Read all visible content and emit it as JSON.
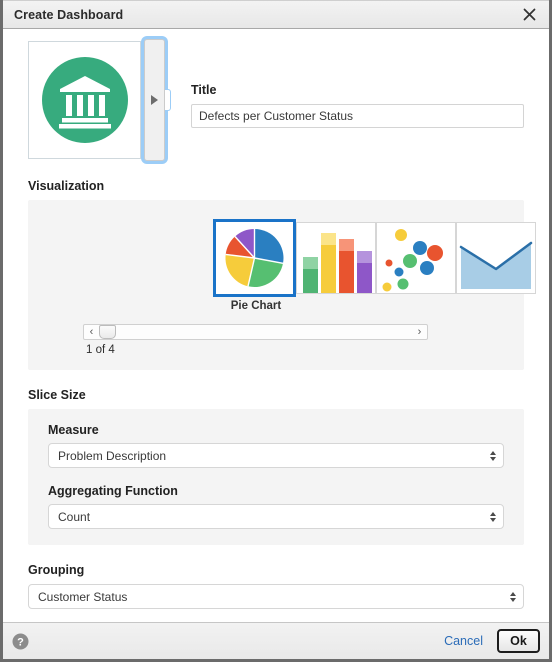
{
  "window": {
    "title": "Create Dashboard",
    "close_icon": "close-icon"
  },
  "header": {
    "app_icon": "bank-icon",
    "expand_arrow_icon": "triangle-right-icon",
    "title_label": "Title",
    "title_value": "Defects per Customer Status",
    "title_placeholder": "Title"
  },
  "visualization": {
    "section_label": "Visualization",
    "selected_caption": "Pie Chart",
    "page_indicator": "1 of 4",
    "prev_arrow": "‹",
    "next_arrow": "›",
    "thumbnails": [
      {
        "name": "Pie Chart",
        "type": "pie",
        "selected": true
      },
      {
        "name": "Bar Chart",
        "type": "bar",
        "selected": false
      },
      {
        "name": "Bubble Chart",
        "type": "scatter",
        "selected": false
      },
      {
        "name": "Area Chart",
        "type": "area",
        "selected": false
      }
    ]
  },
  "slice_size": {
    "section_label": "Slice Size",
    "measure_label": "Measure",
    "measure_value": "Problem Description",
    "aggregating_label": "Aggregating Function",
    "aggregating_value": "Count"
  },
  "grouping": {
    "section_label": "Grouping",
    "value": "Customer Status"
  },
  "footer": {
    "help_icon": "help-icon",
    "cancel_label": "Cancel",
    "ok_label": "Ok"
  },
  "colors": {
    "accent_blue": "#1a73c8",
    "focus_blue": "#9ccdf7",
    "icon_green": "#37ab7e",
    "link_blue": "#2b6cb8",
    "panel_gray": "#f4f4f4",
    "pie_blue": "#2a7fc1",
    "pie_green": "#56bf71",
    "pie_yellow": "#f6cc3b",
    "pie_orange": "#e8542f",
    "pie_purple": "#8e57c8"
  },
  "chart_data": [
    {
      "type": "pie",
      "title": "Pie Chart",
      "categories": [
        "Blue",
        "Green",
        "Yellow",
        "Orange",
        "Purple"
      ],
      "values": [
        22,
        28,
        20,
        13,
        17
      ],
      "legend": "none"
    },
    {
      "type": "bar",
      "title": "Bar Chart",
      "categories": [
        "Green",
        "Yellow",
        "Orange",
        "Purple"
      ],
      "series": [
        {
          "name": "Base",
          "values": [
            30,
            62,
            50,
            38
          ]
        },
        {
          "name": "Top",
          "values": [
            14,
            18,
            16,
            20
          ]
        }
      ],
      "ylim": [
        0,
        100
      ],
      "grid": false
    },
    {
      "type": "scatter",
      "title": "Bubble Chart",
      "points": [
        {
          "x": 30,
          "y": 82,
          "r": 7,
          "color": "#f6cc3b"
        },
        {
          "x": 52,
          "y": 62,
          "r": 8,
          "color": "#2a7fc1"
        },
        {
          "x": 72,
          "y": 58,
          "r": 9,
          "color": "#e8542f"
        },
        {
          "x": 40,
          "y": 44,
          "r": 8,
          "color": "#56bf71"
        },
        {
          "x": 60,
          "y": 36,
          "r": 8,
          "color": "#2a7fc1"
        },
        {
          "x": 26,
          "y": 30,
          "r": 5,
          "color": "#2a7fc1"
        },
        {
          "x": 16,
          "y": 44,
          "r": 4,
          "color": "#e8542f"
        },
        {
          "x": 30,
          "y": 14,
          "r": 6,
          "color": "#56bf71"
        },
        {
          "x": 12,
          "y": 8,
          "r": 5,
          "color": "#f6cc3b"
        }
      ]
    },
    {
      "type": "area",
      "title": "Area Chart",
      "x": [
        0,
        1,
        2
      ],
      "values": [
        62,
        30,
        66
      ],
      "ylim": [
        0,
        100
      ],
      "grid": false
    }
  ]
}
